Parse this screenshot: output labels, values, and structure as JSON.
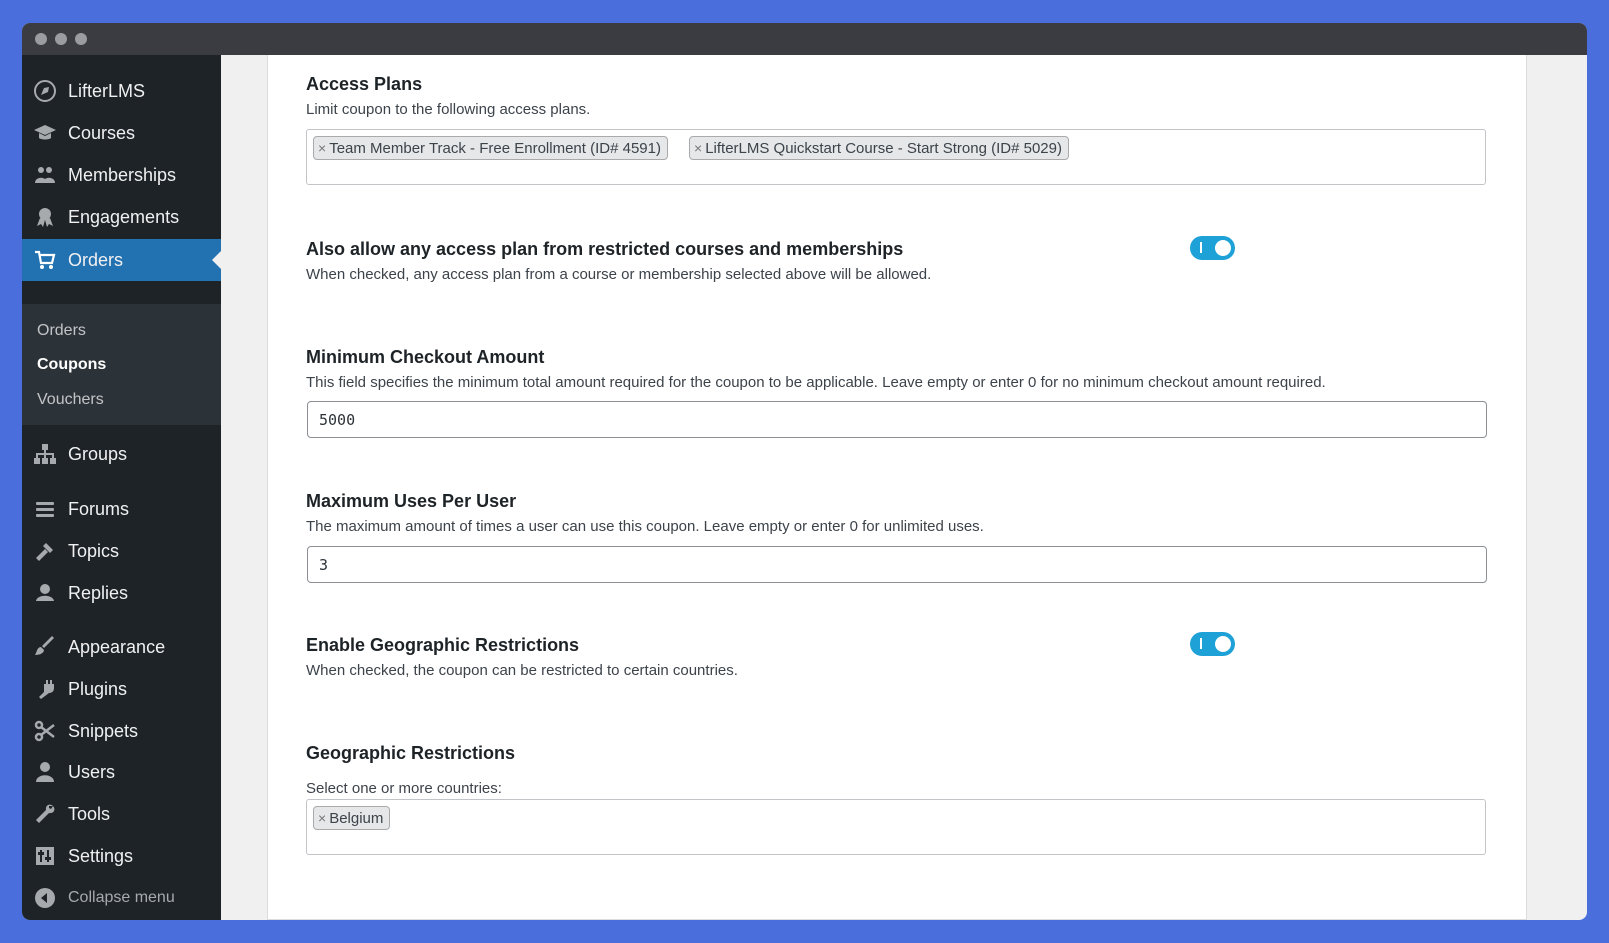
{
  "sidebar": {
    "items": [
      {
        "label": "LifterLMS",
        "icon": "lifterlms-rocket-icon"
      },
      {
        "label": "Courses",
        "icon": "graduation-cap-icon"
      },
      {
        "label": "Memberships",
        "icon": "groups-icon"
      },
      {
        "label": "Engagements",
        "icon": "award-icon"
      },
      {
        "label": "Orders",
        "icon": "cart-icon",
        "active": true
      },
      {
        "label": "Groups",
        "icon": "sitemap-icon"
      },
      {
        "label": "Forums",
        "icon": "forums-icon"
      },
      {
        "label": "Topics",
        "icon": "topics-icon"
      },
      {
        "label": "Replies",
        "icon": "replies-icon"
      },
      {
        "label": "Appearance",
        "icon": "paintbrush-icon"
      },
      {
        "label": "Plugins",
        "icon": "plug-icon"
      },
      {
        "label": "Snippets",
        "icon": "scissors-icon"
      },
      {
        "label": "Users",
        "icon": "user-icon"
      },
      {
        "label": "Tools",
        "icon": "wrench-icon"
      },
      {
        "label": "Settings",
        "icon": "settings-icon"
      }
    ],
    "submenu": [
      {
        "label": "Orders"
      },
      {
        "label": "Coupons",
        "current": true
      },
      {
        "label": "Vouchers"
      }
    ],
    "collapse_label": "Collapse menu"
  },
  "form": {
    "access_plans": {
      "label": "Access Plans",
      "description": "Limit coupon to the following access plans.",
      "tags": [
        "Team Member Track - Free Enrollment (ID# 4591)",
        "LifterLMS Quickstart Course - Start Strong (ID# 5029)"
      ]
    },
    "allow_restricted": {
      "label": "Also allow any access plan from restricted courses and memberships",
      "description": "When checked, any access plan from a course or membership selected above will be allowed.",
      "enabled": true
    },
    "min_checkout": {
      "label": "Minimum Checkout Amount",
      "description": "This field specifies the minimum total amount required for the coupon to be applicable. Leave empty or enter 0 for no minimum checkout amount required.",
      "value": "5000"
    },
    "max_uses": {
      "label": "Maximum Uses Per User",
      "description": "The maximum amount of times a user can use this coupon. Leave empty or enter 0 for unlimited uses.",
      "value": "3"
    },
    "geo_enable": {
      "label": "Enable Geographic Restrictions",
      "description": "When checked, the coupon can be restricted to certain countries.",
      "enabled": true
    },
    "geo_restrictions": {
      "label": "Geographic Restrictions",
      "description": "Select one or more countries:",
      "tags": [
        "Belgium"
      ]
    }
  },
  "colors": {
    "accent": "#2271b1",
    "toggle_on": "#1da1d6",
    "sidebar_bg": "#1d2327",
    "frame_bg": "#4a6fdc"
  }
}
